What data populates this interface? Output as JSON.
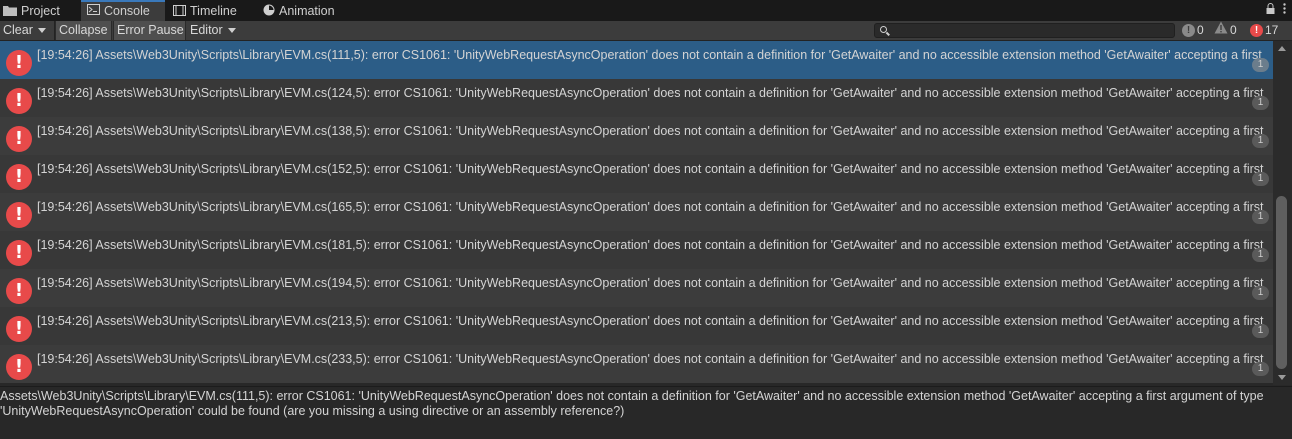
{
  "tabs": [
    {
      "label": "Project",
      "icon": "folder-icon"
    },
    {
      "label": "Console",
      "icon": "console-icon",
      "active": true
    },
    {
      "label": "Timeline",
      "icon": "timeline-icon"
    },
    {
      "label": "Animation",
      "icon": "animation-icon"
    }
  ],
  "toolbar": {
    "clear": "Clear",
    "collapse": "Collapse",
    "error_pause": "Error Pause",
    "editor": "Editor",
    "search_placeholder": "",
    "info_count": "0",
    "warning_count": "0",
    "error_count": "17"
  },
  "rows": [
    {
      "text": "[19:54:26] Assets\\Web3Unity\\Scripts\\Library\\EVM.cs(111,5): error CS1061: 'UnityWebRequestAsyncOperation' does not contain a definition for 'GetAwaiter' and no accessible extension method 'GetAwaiter' accepting a first",
      "count": "1"
    },
    {
      "text": "[19:54:26] Assets\\Web3Unity\\Scripts\\Library\\EVM.cs(124,5): error CS1061: 'UnityWebRequestAsyncOperation' does not contain a definition for 'GetAwaiter' and no accessible extension method 'GetAwaiter' accepting a first",
      "count": "1"
    },
    {
      "text": "[19:54:26] Assets\\Web3Unity\\Scripts\\Library\\EVM.cs(138,5): error CS1061: 'UnityWebRequestAsyncOperation' does not contain a definition for 'GetAwaiter' and no accessible extension method 'GetAwaiter' accepting a first",
      "count": "1"
    },
    {
      "text": "[19:54:26] Assets\\Web3Unity\\Scripts\\Library\\EVM.cs(152,5): error CS1061: 'UnityWebRequestAsyncOperation' does not contain a definition for 'GetAwaiter' and no accessible extension method 'GetAwaiter' accepting a first",
      "count": "1"
    },
    {
      "text": "[19:54:26] Assets\\Web3Unity\\Scripts\\Library\\EVM.cs(165,5): error CS1061: 'UnityWebRequestAsyncOperation' does not contain a definition for 'GetAwaiter' and no accessible extension method 'GetAwaiter' accepting a first",
      "count": "1"
    },
    {
      "text": "[19:54:26] Assets\\Web3Unity\\Scripts\\Library\\EVM.cs(181,5): error CS1061: 'UnityWebRequestAsyncOperation' does not contain a definition for 'GetAwaiter' and no accessible extension method 'GetAwaiter' accepting a first",
      "count": "1"
    },
    {
      "text": "[19:54:26] Assets\\Web3Unity\\Scripts\\Library\\EVM.cs(194,5): error CS1061: 'UnityWebRequestAsyncOperation' does not contain a definition for 'GetAwaiter' and no accessible extension method 'GetAwaiter' accepting a first",
      "count": "1"
    },
    {
      "text": "[19:54:26] Assets\\Web3Unity\\Scripts\\Library\\EVM.cs(213,5): error CS1061: 'UnityWebRequestAsyncOperation' does not contain a definition for 'GetAwaiter' and no accessible extension method 'GetAwaiter' accepting a first",
      "count": "1"
    },
    {
      "text": "[19:54:26] Assets\\Web3Unity\\Scripts\\Library\\EVM.cs(233,5): error CS1061: 'UnityWebRequestAsyncOperation' does not contain a definition for 'GetAwaiter' and no accessible extension method 'GetAwaiter' accepting a first",
      "count": "1"
    }
  ],
  "detail": {
    "line1": "Assets\\Web3Unity\\Scripts\\Library\\EVM.cs(111,5): error CS1061: 'UnityWebRequestAsyncOperation' does not contain a definition for 'GetAwaiter' and no accessible extension method 'GetAwaiter' accepting a first argument of type",
    "line2": "'UnityWebRequestAsyncOperation' could be found (are you missing a using directive or an assembly reference?)"
  },
  "colors": {
    "selected_row": "#2c5d87",
    "error_red": "#e84a4a",
    "active_tab_accent": "#3a79bb"
  }
}
